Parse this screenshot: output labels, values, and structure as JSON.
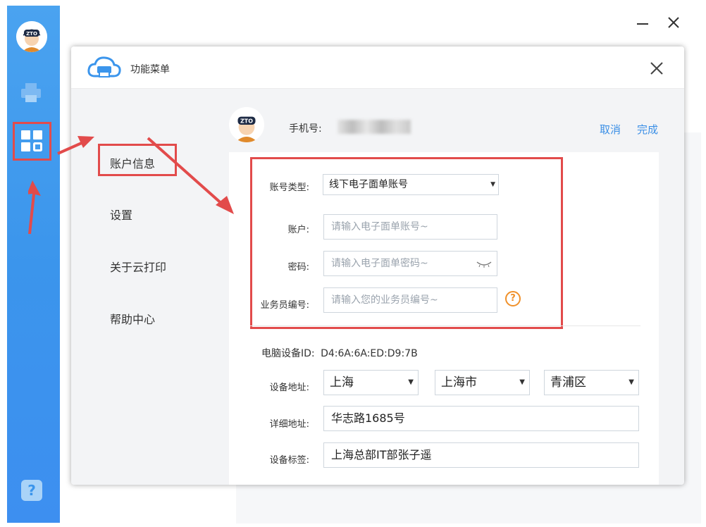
{
  "window": {
    "minimize_icon": "minimize-icon",
    "close_icon": "close-icon"
  },
  "rail": {
    "items": [
      {
        "icon": "avatar-icon"
      },
      {
        "icon": "printer-icon"
      },
      {
        "icon": "grid-apps-icon",
        "highlighted": true
      },
      {
        "icon": "help-icon"
      }
    ],
    "help_glyph": "?"
  },
  "dialog": {
    "title": "功能菜单",
    "close_icon": "close-icon",
    "menu": [
      {
        "label": "账户信息",
        "active": true
      },
      {
        "label": "设置"
      },
      {
        "label": "关于云打印"
      },
      {
        "label": "帮助中心"
      }
    ],
    "account": {
      "phone_label": "手机号:",
      "cancel_label": "取消",
      "done_label": "完成"
    },
    "form": {
      "account_type": {
        "label": "账号类型:",
        "value": "线下电子面单账号"
      },
      "account": {
        "label": "账户:",
        "placeholder": "请输入电子面单账号~"
      },
      "password": {
        "label": "密码:",
        "placeholder": "请输入电子面单密码~",
        "icon": "eye-closed-icon"
      },
      "salesman": {
        "label": "业务员编号:",
        "placeholder": "请输入您的业务员编号~",
        "help_glyph": "?"
      }
    },
    "device": {
      "id_label": "电脑设备ID:",
      "id_value": "D4:6A:6A:ED:D9:7B",
      "address_label": "设备地址:",
      "province": "上海",
      "city": "上海市",
      "district": "青浦区",
      "detail_label": "详细地址:",
      "detail_value": "华志路1685号",
      "tag_label": "设备标签:",
      "tag_value": "上海总部IT部张子遥"
    }
  },
  "colors": {
    "rail_blue": "#3b95ec",
    "highlight_red": "#e24b4b",
    "link_blue": "#3b8fe6",
    "help_orange": "#f0902a"
  }
}
